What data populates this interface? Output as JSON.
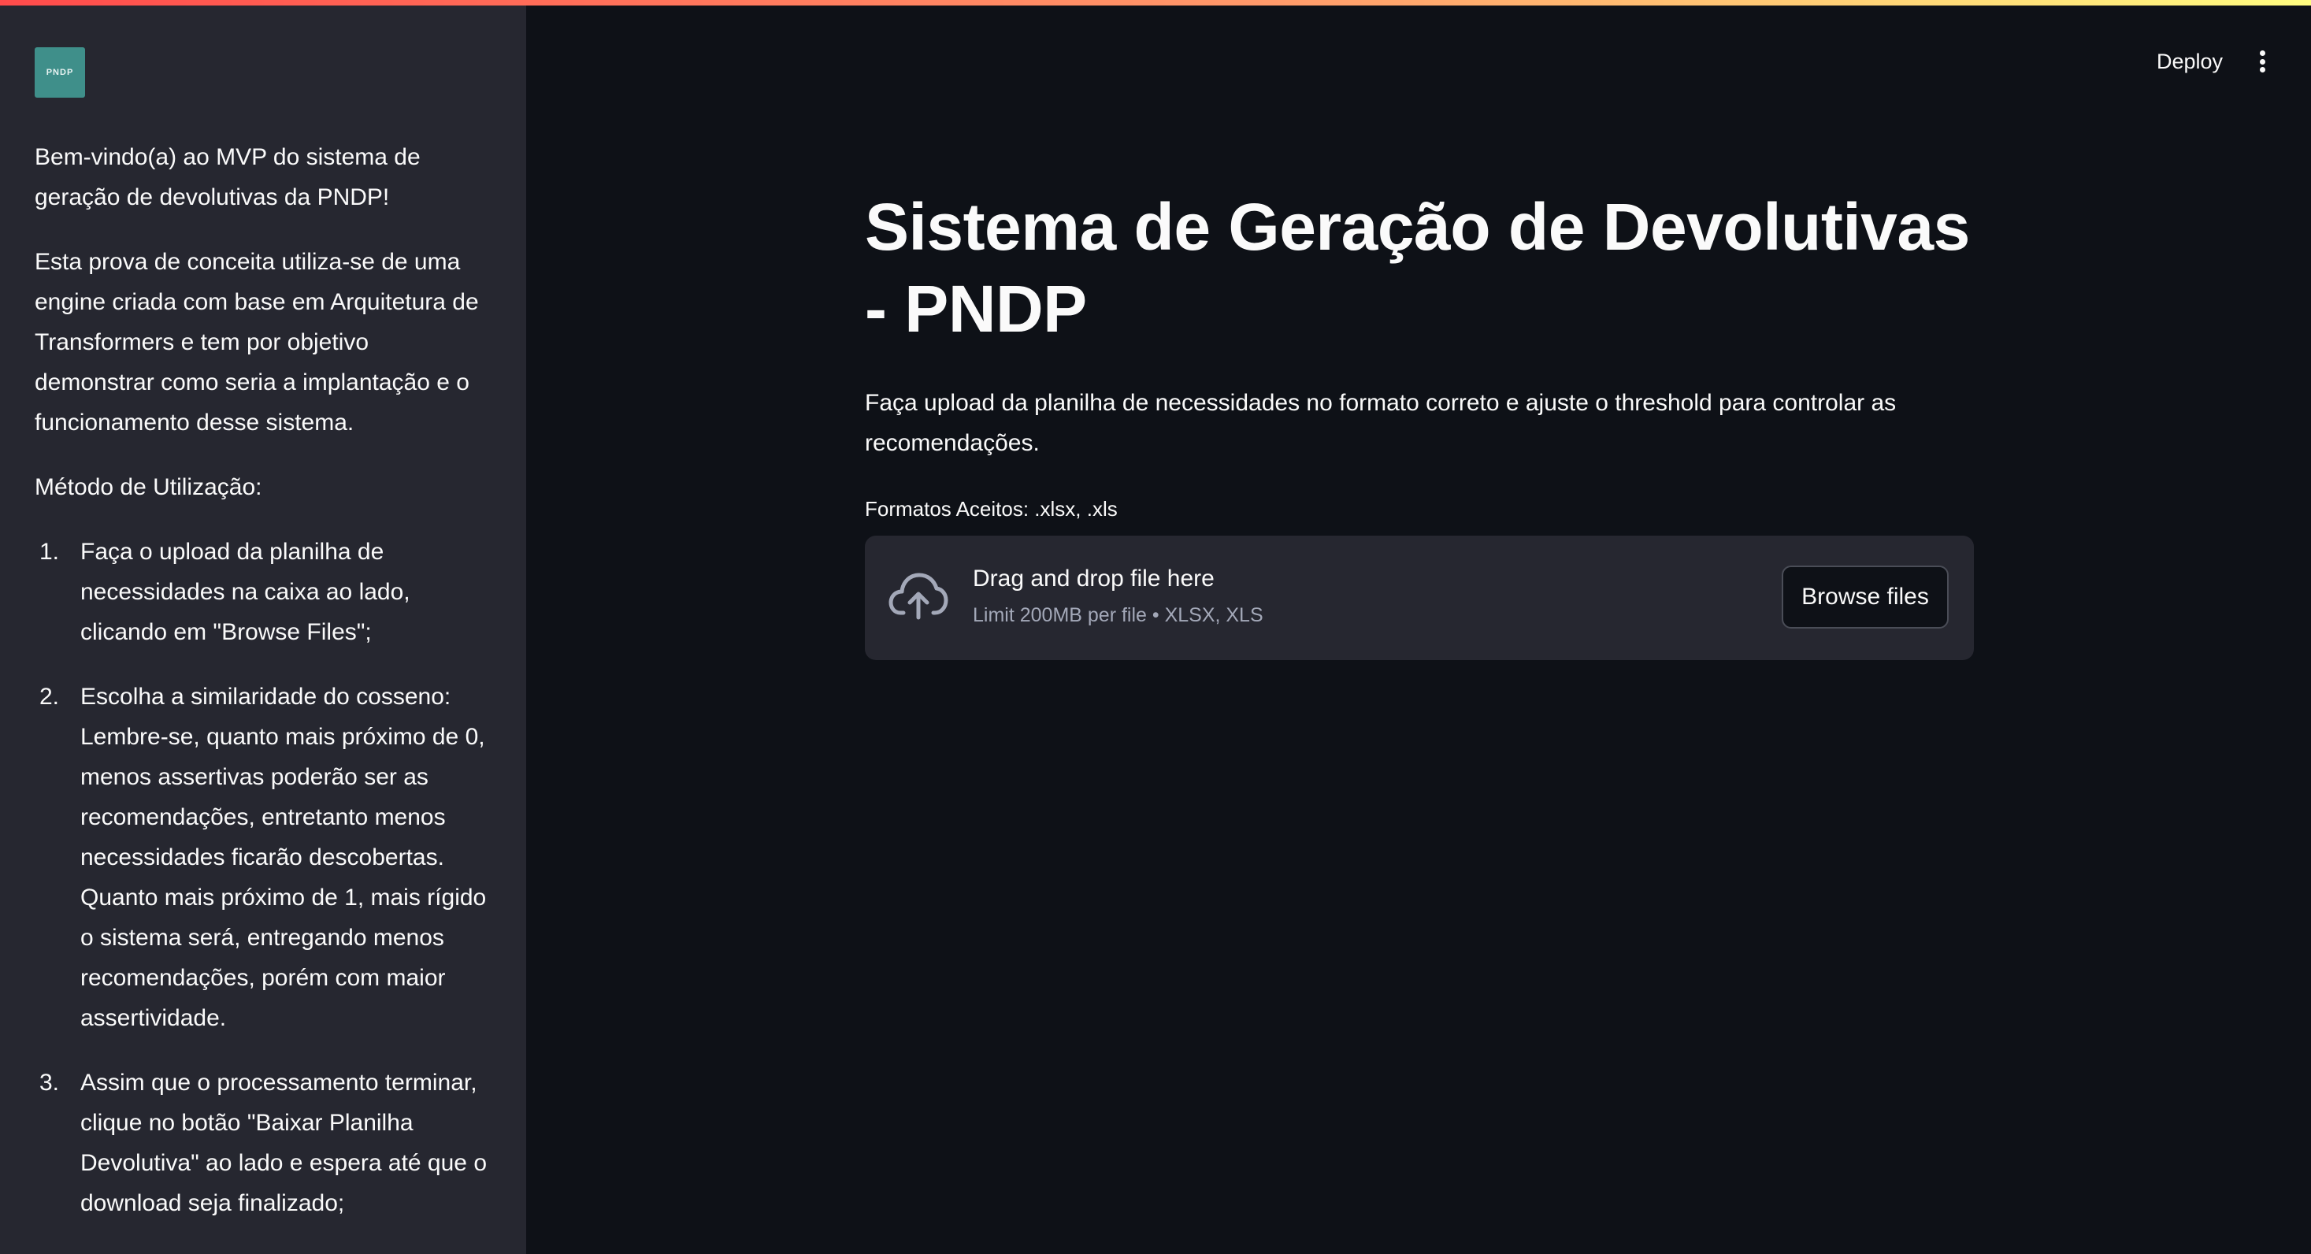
{
  "sidebar": {
    "logo_text": "PNDP",
    "welcome": "Bem-vindo(a) ao MVP do sistema de geração de devolutivas da PNDP!",
    "intro": "Esta prova de conceita utiliza-se de uma engine criada com base em Arquitetura de Transformers e tem por objetivo demonstrar como seria a implantação e o funcionamento desse sistema.",
    "method_title": "Método de Utilização:",
    "steps": [
      {
        "num": "1.",
        "text": "Faça o upload da planilha de necessidades na caixa ao lado, clicando em \"Browse Files\";"
      },
      {
        "num": "2.",
        "text": "Escolha a similaridade do cosseno: Lembre-se, quanto mais próximo de 0, menos assertivas poderão ser as recomendações, entretanto menos necessidades ficarão descobertas. Quanto mais próximo de 1, mais rígido o sistema será, entregando menos recomendações, porém com maior assertividade."
      },
      {
        "num": "3.",
        "text": "Assim que o processamento terminar, clique no botão \"Baixar Planilha Devolutiva\" ao lado e espera até que o download seja finalizado;"
      }
    ]
  },
  "header": {
    "deploy_label": "Deploy",
    "menu_icon": "vertical-ellipsis-icon"
  },
  "main": {
    "title": "Sistema de Geração de Devolutivas - PNDP",
    "description": "Faça upload da planilha de necessidades no formato correto e ajuste o threshold para controlar as recomendações.",
    "formats_label": "Formatos Aceitos: .xlsx, .xls",
    "uploader": {
      "icon": "cloud-upload-icon",
      "drop_title": "Drag and drop file here",
      "limit_text": "Limit 200MB per file • XLSX, XLS",
      "browse_label": "Browse files"
    }
  },
  "colors": {
    "background": "#0e1117",
    "sidebar": "#262730",
    "logo": "#3f8f8a",
    "muted_text": "#a3a8b8"
  }
}
